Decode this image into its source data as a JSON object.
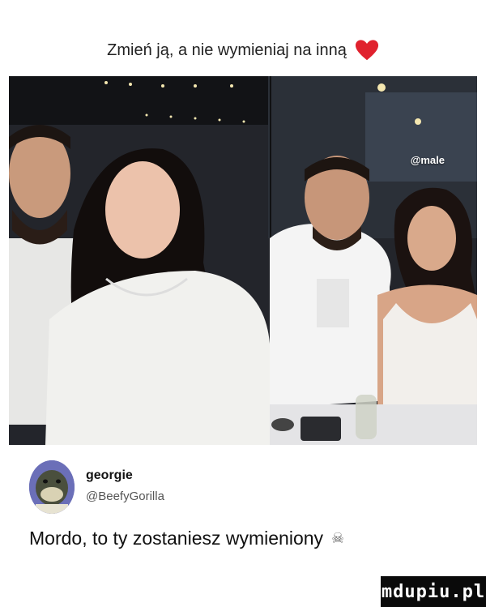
{
  "caption": {
    "text": "Zmień ją, a nie wymieniaj na inną"
  },
  "photo": {
    "watermark": "@male"
  },
  "tweet": {
    "name": "georgie",
    "handle": "@BeefyGorilla",
    "text": "Mordo, to ty zostaniesz wymieniony"
  },
  "footer": {
    "site_logo": "mdupiu.pl"
  },
  "colors": {
    "heart": "#e0222e",
    "avatar_bg": "#6b6fb8",
    "logo_bg": "#0a0a0a"
  },
  "icons": {
    "heart": "red-heart-icon",
    "skull": "skull-icon"
  }
}
